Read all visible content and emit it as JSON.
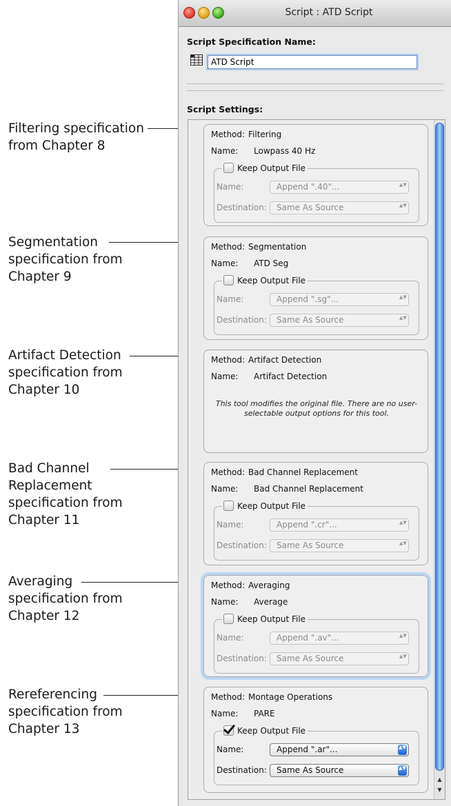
{
  "window": {
    "title": "Script : ATD Script"
  },
  "spec_name": {
    "label": "Script Specification Name:",
    "value": "ATD Script"
  },
  "settings": {
    "label": "Script Settings:",
    "note": "This tool modifies the original file.  There are no user-selectable output options for this tool.",
    "method_label": "Method:",
    "name_label": "Name:",
    "keep_output_label": "Keep Output File",
    "field_name_label": "Name:",
    "field_destination_label": "Destination:",
    "panels": [
      {
        "method": "Filtering",
        "name": "Lowpass 40 Hz",
        "keep_output": false,
        "append": "Append \".40\"...",
        "destination": "Same As Source"
      },
      {
        "method": "Segmentation",
        "name": "ATD Seg",
        "keep_output": false,
        "append": "Append \".sg\"...",
        "destination": "Same As Source"
      },
      {
        "method": "Artifact Detection",
        "name": "Artifact Detection"
      },
      {
        "method": "Bad Channel Replacement",
        "name": "Bad Channel Replacement",
        "keep_output": false,
        "append": "Append \".cr\"...",
        "destination": "Same As Source"
      },
      {
        "method": "Averaging",
        "name": "Average",
        "keep_output": false,
        "append": "Append \".av\"...",
        "destination": "Same As Source"
      },
      {
        "method": "Montage Operations",
        "name": "PARE",
        "keep_output": true,
        "append": "Append \".ar\"...",
        "destination": "Same As Source"
      }
    ]
  },
  "callouts": [
    {
      "lines": [
        "Filtering specification",
        "from Chapter 8"
      ]
    },
    {
      "lines": [
        "Segmentation",
        "specification from",
        "Chapter 9"
      ]
    },
    {
      "lines": [
        "Artifact Detection",
        "specification from",
        "Chapter 10"
      ]
    },
    {
      "lines": [
        "Bad Channel",
        "Replacement",
        "specification from",
        "Chapter 11"
      ]
    },
    {
      "lines": [
        "Averaging",
        "specification from",
        "Chapter 12"
      ]
    },
    {
      "lines": [
        "Rereferencing",
        "specification from",
        "Chapter 13"
      ]
    }
  ],
  "scrollbar": {
    "up_arrow": "▲",
    "down_arrow": "▼"
  },
  "popup_arrows": "▲▼"
}
